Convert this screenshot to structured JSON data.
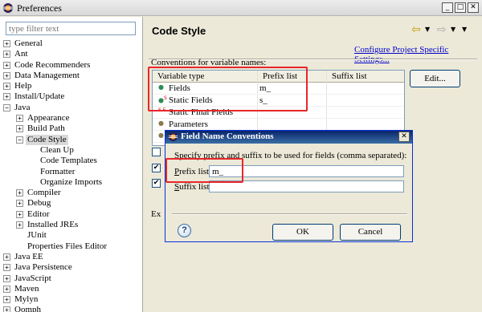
{
  "window": {
    "title": "Preferences"
  },
  "filter": {
    "placeholder": "type filter text"
  },
  "tree": [
    {
      "label": "General",
      "expander": "+",
      "level": 0
    },
    {
      "label": "Ant",
      "expander": "+",
      "level": 0
    },
    {
      "label": "Code Recommenders",
      "expander": "+",
      "level": 0
    },
    {
      "label": "Data Management",
      "expander": "+",
      "level": 0
    },
    {
      "label": "Help",
      "expander": "+",
      "level": 0
    },
    {
      "label": "Install/Update",
      "expander": "+",
      "level": 0
    },
    {
      "label": "Java",
      "expander": "−",
      "level": 0
    },
    {
      "label": "Appearance",
      "expander": "+",
      "level": 1
    },
    {
      "label": "Build Path",
      "expander": "+",
      "level": 1
    },
    {
      "label": "Code Style",
      "expander": "−",
      "level": 1,
      "selected": true
    },
    {
      "label": "Clean Up",
      "expander": "",
      "level": 2
    },
    {
      "label": "Code Templates",
      "expander": "",
      "level": 2
    },
    {
      "label": "Formatter",
      "expander": "",
      "level": 2
    },
    {
      "label": "Organize Imports",
      "expander": "",
      "level": 2
    },
    {
      "label": "Compiler",
      "expander": "+",
      "level": 1
    },
    {
      "label": "Debug",
      "expander": "+",
      "level": 1
    },
    {
      "label": "Editor",
      "expander": "+",
      "level": 1
    },
    {
      "label": "Installed JREs",
      "expander": "+",
      "level": 1
    },
    {
      "label": "JUnit",
      "expander": "",
      "level": 1
    },
    {
      "label": "Properties Files Editor",
      "expander": "",
      "level": 1
    },
    {
      "label": "Java EE",
      "expander": "+",
      "level": 0
    },
    {
      "label": "Java Persistence",
      "expander": "+",
      "level": 0
    },
    {
      "label": "JavaScript",
      "expander": "+",
      "level": 0
    },
    {
      "label": "Maven",
      "expander": "+",
      "level": 0
    },
    {
      "label": "Mylyn",
      "expander": "+",
      "level": 0
    },
    {
      "label": "Oomph",
      "expander": "+",
      "level": 0
    }
  ],
  "page": {
    "title": "Code Style",
    "config_link": "Configure Project Specific Settings...",
    "conventions_label": "Conventions for variable names:",
    "edit_button": "Edit...",
    "ex_label": "Ex"
  },
  "table": {
    "columns": [
      "Variable type",
      "Prefix list",
      "Suffix list"
    ],
    "rows": [
      {
        "type": "Fields",
        "prefix": "m_",
        "suffix": ""
      },
      {
        "type": "Static Fields",
        "prefix": "s_",
        "suffix": ""
      },
      {
        "type": "Static Final Fields",
        "prefix": "",
        "suffix": ""
      },
      {
        "type": "Parameters",
        "prefix": "",
        "suffix": ""
      },
      {
        "type": "",
        "prefix": "",
        "suffix": ""
      }
    ]
  },
  "checkboxes": [
    {
      "checked": false
    },
    {
      "checked": true
    },
    {
      "checked": true
    }
  ],
  "dialog": {
    "title": "Field Name Conventions",
    "message": "Specify prefix and suffix to be used for fields (comma separated):",
    "prefix_label": "Prefix list:",
    "prefix_value": "m_",
    "suffix_label": "Suffix list:",
    "suffix_value": "",
    "ok": "OK",
    "cancel": "Cancel"
  },
  "colors": {
    "highlight": "#e8262a",
    "dialog_title": "#0a246a"
  }
}
